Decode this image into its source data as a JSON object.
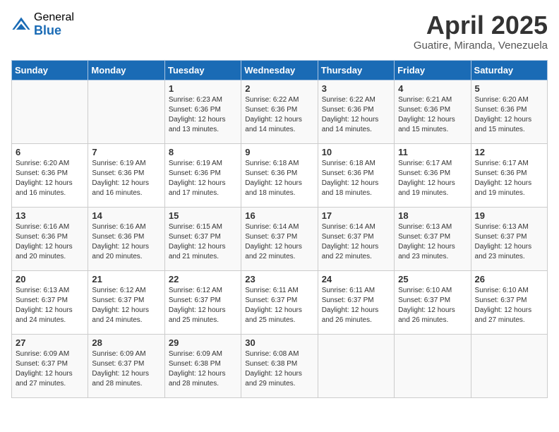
{
  "logo": {
    "general": "General",
    "blue": "Blue"
  },
  "header": {
    "title": "April 2025",
    "subtitle": "Guatire, Miranda, Venezuela"
  },
  "weekdays": [
    "Sunday",
    "Monday",
    "Tuesday",
    "Wednesday",
    "Thursday",
    "Friday",
    "Saturday"
  ],
  "weeks": [
    [
      {
        "day": "",
        "sunrise": "",
        "sunset": "",
        "daylight": ""
      },
      {
        "day": "",
        "sunrise": "",
        "sunset": "",
        "daylight": ""
      },
      {
        "day": "1",
        "sunrise": "Sunrise: 6:23 AM",
        "sunset": "Sunset: 6:36 PM",
        "daylight": "Daylight: 12 hours and 13 minutes."
      },
      {
        "day": "2",
        "sunrise": "Sunrise: 6:22 AM",
        "sunset": "Sunset: 6:36 PM",
        "daylight": "Daylight: 12 hours and 14 minutes."
      },
      {
        "day": "3",
        "sunrise": "Sunrise: 6:22 AM",
        "sunset": "Sunset: 6:36 PM",
        "daylight": "Daylight: 12 hours and 14 minutes."
      },
      {
        "day": "4",
        "sunrise": "Sunrise: 6:21 AM",
        "sunset": "Sunset: 6:36 PM",
        "daylight": "Daylight: 12 hours and 15 minutes."
      },
      {
        "day": "5",
        "sunrise": "Sunrise: 6:20 AM",
        "sunset": "Sunset: 6:36 PM",
        "daylight": "Daylight: 12 hours and 15 minutes."
      }
    ],
    [
      {
        "day": "6",
        "sunrise": "Sunrise: 6:20 AM",
        "sunset": "Sunset: 6:36 PM",
        "daylight": "Daylight: 12 hours and 16 minutes."
      },
      {
        "day": "7",
        "sunrise": "Sunrise: 6:19 AM",
        "sunset": "Sunset: 6:36 PM",
        "daylight": "Daylight: 12 hours and 16 minutes."
      },
      {
        "day": "8",
        "sunrise": "Sunrise: 6:19 AM",
        "sunset": "Sunset: 6:36 PM",
        "daylight": "Daylight: 12 hours and 17 minutes."
      },
      {
        "day": "9",
        "sunrise": "Sunrise: 6:18 AM",
        "sunset": "Sunset: 6:36 PM",
        "daylight": "Daylight: 12 hours and 18 minutes."
      },
      {
        "day": "10",
        "sunrise": "Sunrise: 6:18 AM",
        "sunset": "Sunset: 6:36 PM",
        "daylight": "Daylight: 12 hours and 18 minutes."
      },
      {
        "day": "11",
        "sunrise": "Sunrise: 6:17 AM",
        "sunset": "Sunset: 6:36 PM",
        "daylight": "Daylight: 12 hours and 19 minutes."
      },
      {
        "day": "12",
        "sunrise": "Sunrise: 6:17 AM",
        "sunset": "Sunset: 6:36 PM",
        "daylight": "Daylight: 12 hours and 19 minutes."
      }
    ],
    [
      {
        "day": "13",
        "sunrise": "Sunrise: 6:16 AM",
        "sunset": "Sunset: 6:36 PM",
        "daylight": "Daylight: 12 hours and 20 minutes."
      },
      {
        "day": "14",
        "sunrise": "Sunrise: 6:16 AM",
        "sunset": "Sunset: 6:36 PM",
        "daylight": "Daylight: 12 hours and 20 minutes."
      },
      {
        "day": "15",
        "sunrise": "Sunrise: 6:15 AM",
        "sunset": "Sunset: 6:37 PM",
        "daylight": "Daylight: 12 hours and 21 minutes."
      },
      {
        "day": "16",
        "sunrise": "Sunrise: 6:14 AM",
        "sunset": "Sunset: 6:37 PM",
        "daylight": "Daylight: 12 hours and 22 minutes."
      },
      {
        "day": "17",
        "sunrise": "Sunrise: 6:14 AM",
        "sunset": "Sunset: 6:37 PM",
        "daylight": "Daylight: 12 hours and 22 minutes."
      },
      {
        "day": "18",
        "sunrise": "Sunrise: 6:13 AM",
        "sunset": "Sunset: 6:37 PM",
        "daylight": "Daylight: 12 hours and 23 minutes."
      },
      {
        "day": "19",
        "sunrise": "Sunrise: 6:13 AM",
        "sunset": "Sunset: 6:37 PM",
        "daylight": "Daylight: 12 hours and 23 minutes."
      }
    ],
    [
      {
        "day": "20",
        "sunrise": "Sunrise: 6:13 AM",
        "sunset": "Sunset: 6:37 PM",
        "daylight": "Daylight: 12 hours and 24 minutes."
      },
      {
        "day": "21",
        "sunrise": "Sunrise: 6:12 AM",
        "sunset": "Sunset: 6:37 PM",
        "daylight": "Daylight: 12 hours and 24 minutes."
      },
      {
        "day": "22",
        "sunrise": "Sunrise: 6:12 AM",
        "sunset": "Sunset: 6:37 PM",
        "daylight": "Daylight: 12 hours and 25 minutes."
      },
      {
        "day": "23",
        "sunrise": "Sunrise: 6:11 AM",
        "sunset": "Sunset: 6:37 PM",
        "daylight": "Daylight: 12 hours and 25 minutes."
      },
      {
        "day": "24",
        "sunrise": "Sunrise: 6:11 AM",
        "sunset": "Sunset: 6:37 PM",
        "daylight": "Daylight: 12 hours and 26 minutes."
      },
      {
        "day": "25",
        "sunrise": "Sunrise: 6:10 AM",
        "sunset": "Sunset: 6:37 PM",
        "daylight": "Daylight: 12 hours and 26 minutes."
      },
      {
        "day": "26",
        "sunrise": "Sunrise: 6:10 AM",
        "sunset": "Sunset: 6:37 PM",
        "daylight": "Daylight: 12 hours and 27 minutes."
      }
    ],
    [
      {
        "day": "27",
        "sunrise": "Sunrise: 6:09 AM",
        "sunset": "Sunset: 6:37 PM",
        "daylight": "Daylight: 12 hours and 27 minutes."
      },
      {
        "day": "28",
        "sunrise": "Sunrise: 6:09 AM",
        "sunset": "Sunset: 6:37 PM",
        "daylight": "Daylight: 12 hours and 28 minutes."
      },
      {
        "day": "29",
        "sunrise": "Sunrise: 6:09 AM",
        "sunset": "Sunset: 6:38 PM",
        "daylight": "Daylight: 12 hours and 28 minutes."
      },
      {
        "day": "30",
        "sunrise": "Sunrise: 6:08 AM",
        "sunset": "Sunset: 6:38 PM",
        "daylight": "Daylight: 12 hours and 29 minutes."
      },
      {
        "day": "",
        "sunrise": "",
        "sunset": "",
        "daylight": ""
      },
      {
        "day": "",
        "sunrise": "",
        "sunset": "",
        "daylight": ""
      },
      {
        "day": "",
        "sunrise": "",
        "sunset": "",
        "daylight": ""
      }
    ]
  ]
}
